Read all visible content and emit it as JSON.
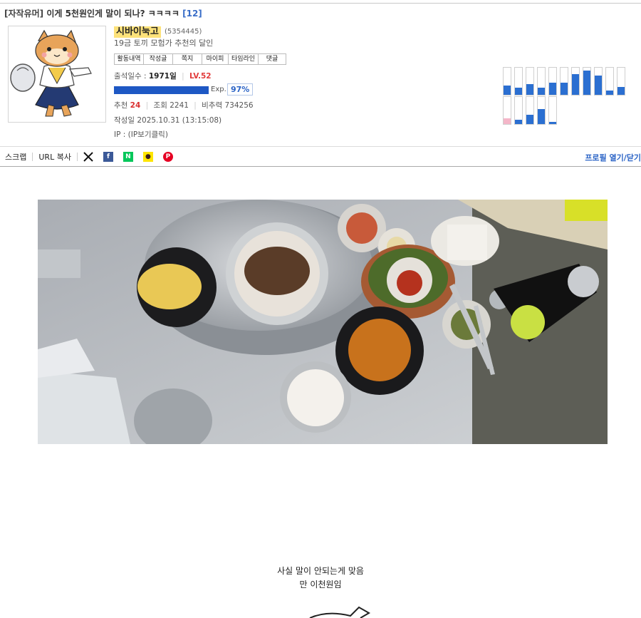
{
  "post": {
    "category": "[자작유머]",
    "title": "이게 5천원인게 말이 되나? ㅋㅋㅋㅋ",
    "comment_count": "[12]"
  },
  "author": {
    "nickname": "시바이눅고",
    "user_id": "(5354445)",
    "title": "19금 토끼 모험가 추천의 달인",
    "buttons": [
      "활동내역",
      "작성글",
      "쪽지",
      "마이피",
      "타임라인",
      "댓글"
    ],
    "attendance_label": "출석일수 :",
    "attendance_value": "1971일",
    "level": "LV.52",
    "exp_label": "Exp.",
    "exp_pct": "97%",
    "exp_fraction": 0.97
  },
  "stats": {
    "recommend_label": "추천",
    "recommend_value": "24",
    "views_label": "조회",
    "views_value": "2241",
    "ratio_label": "비추력",
    "ratio_value": "734256",
    "date_label": "작성일",
    "date_value": "2025.10.31",
    "time_value": "(13:15:08)",
    "ip_label": "IP :",
    "ip_value": "(IP보기클릭)"
  },
  "activity_bars": {
    "top_row": [
      0.35,
      0.25,
      0.4,
      0.25,
      0.45,
      0.45,
      0.75,
      0.9,
      0.7,
      0.15,
      0.3
    ],
    "bottom_row": [
      0.2,
      0.15,
      0.35,
      0.55,
      0.08
    ],
    "colors": {
      "blue": "#2b6fd1",
      "pink": "#f4b6c8"
    }
  },
  "share": {
    "scrap": "스크랩",
    "url_copy": "URL 복사",
    "icons": [
      "x-icon",
      "facebook-icon",
      "naver-icon",
      "kakao-icon",
      "pinterest-icon"
    ],
    "profile_toggle": "프로필 열기/닫기"
  },
  "body": {
    "line1": "사실 말이 안되는게 맞음",
    "line2": "만 이천원임"
  },
  "colors": {
    "accent": "#2a63c6",
    "highlight": "#fde27a",
    "level": "#e23b3b"
  }
}
